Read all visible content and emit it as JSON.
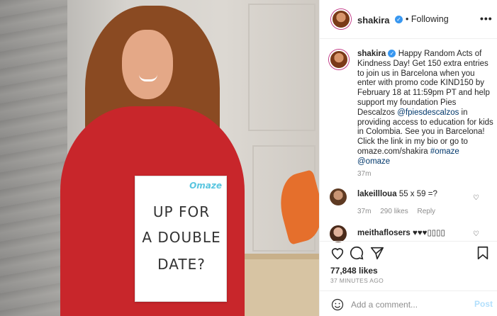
{
  "post_image": {
    "sign_brand": "Omaze",
    "sign_lines": [
      "UP FOR",
      "A DOUBLE",
      "DATE?"
    ]
  },
  "header": {
    "username": "shakira",
    "separator": "•",
    "follow_label": "Following",
    "more_label": "•••"
  },
  "caption": {
    "username": "shakira",
    "text_1": "Happy Random Acts of Kindness Day! Get 150 extra entries to join us in Barcelona when you enter with promo code KIND150 by February 18 at 11:59pm PT and help support my foundation Pies Descalzos ",
    "mention_1": "@fpiesdescalzos",
    "text_2": " in providing access to education for kids in Colombia. See you in Barcelona! Click the link in my bio or go to omaze.com/shakira ",
    "hashtag": "#omaze",
    "mention_2": "@omaze",
    "time": "37m"
  },
  "comments": [
    {
      "username": "lakeillloua",
      "text": "55 x 59 =?",
      "time": "37m",
      "likes": "290 likes",
      "reply": "Reply"
    },
    {
      "username": "meithaflosers",
      "text": "♥♥♥▯▯▯▯"
    }
  ],
  "likes_count": "77,848 likes",
  "time_ago": "37 MINUTES AGO",
  "add_comment": {
    "placeholder": "Add a comment...",
    "post_label": "Post"
  },
  "colors": {
    "verified": "#3897f0",
    "link": "#00376b",
    "post_button": "#b2dffc",
    "meta": "#8e8e8e"
  }
}
